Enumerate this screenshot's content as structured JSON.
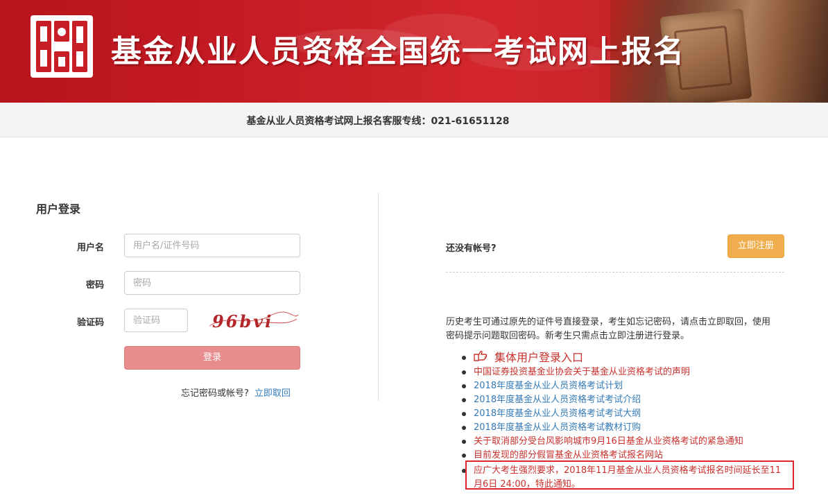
{
  "header": {
    "title": "基金从业人员资格全国统一考试网上报名",
    "logo_icon": "seal-logo-icon",
    "brand_color": "#c71d26"
  },
  "hotline": {
    "text": "基金从业人员资格考试网上报名客服专线：021-61651128"
  },
  "login": {
    "title": "用户登录",
    "username_label": "用户名",
    "username_placeholder": "用户名/证件号码",
    "password_label": "密码",
    "password_placeholder": "密码",
    "captcha_label": "验证码",
    "captcha_placeholder": "验证码",
    "captcha_text": "96bvi",
    "login_button": "登录",
    "forgot_text": "忘记密码或帐号?",
    "forgot_link": "立即取回"
  },
  "register": {
    "no_account": "还没有帐号?",
    "register_button": "立即注册",
    "info": "历史考生可通过原先的证件号直接登录，考生如忘记密码，请点击立即取回，使用密码提示问题取回密码。新考生只需点击立即注册进行登录。"
  },
  "news": {
    "group_login": "集体用户登录入口",
    "group_icon": "pointing-hand-icon",
    "items": [
      {
        "text": "中国证券投资基金业协会关于基金从业资格考试的声明",
        "color": "red"
      },
      {
        "text": "2018年度基金从业人员资格考试计划",
        "color": "blue"
      },
      {
        "text": "2018年度基金从业人员资格考试考试介绍",
        "color": "blue"
      },
      {
        "text": "2018年度基金从业人员资格考试考试大纲",
        "color": "blue"
      },
      {
        "text": "2018年度基金从业人员资格考试教材订购",
        "color": "blue"
      },
      {
        "text": "关于取消部分受台风影响城市9月16日基金从业资格考试的紧急通知",
        "color": "red"
      },
      {
        "text": "目前发现的部分假冒基金从业资格考试报名网站",
        "color": "red"
      }
    ],
    "notice": "应广大考生强烈要求，2018年11月基金从业人员资格考试报名时间延长至11月6日 24:00，特此通知。"
  },
  "colors": {
    "link_blue": "#337ab7",
    "link_red": "#c9302c",
    "login_button": "#e88d8d",
    "register_button": "#f0ad4e",
    "notice_border": "#e0262b"
  }
}
